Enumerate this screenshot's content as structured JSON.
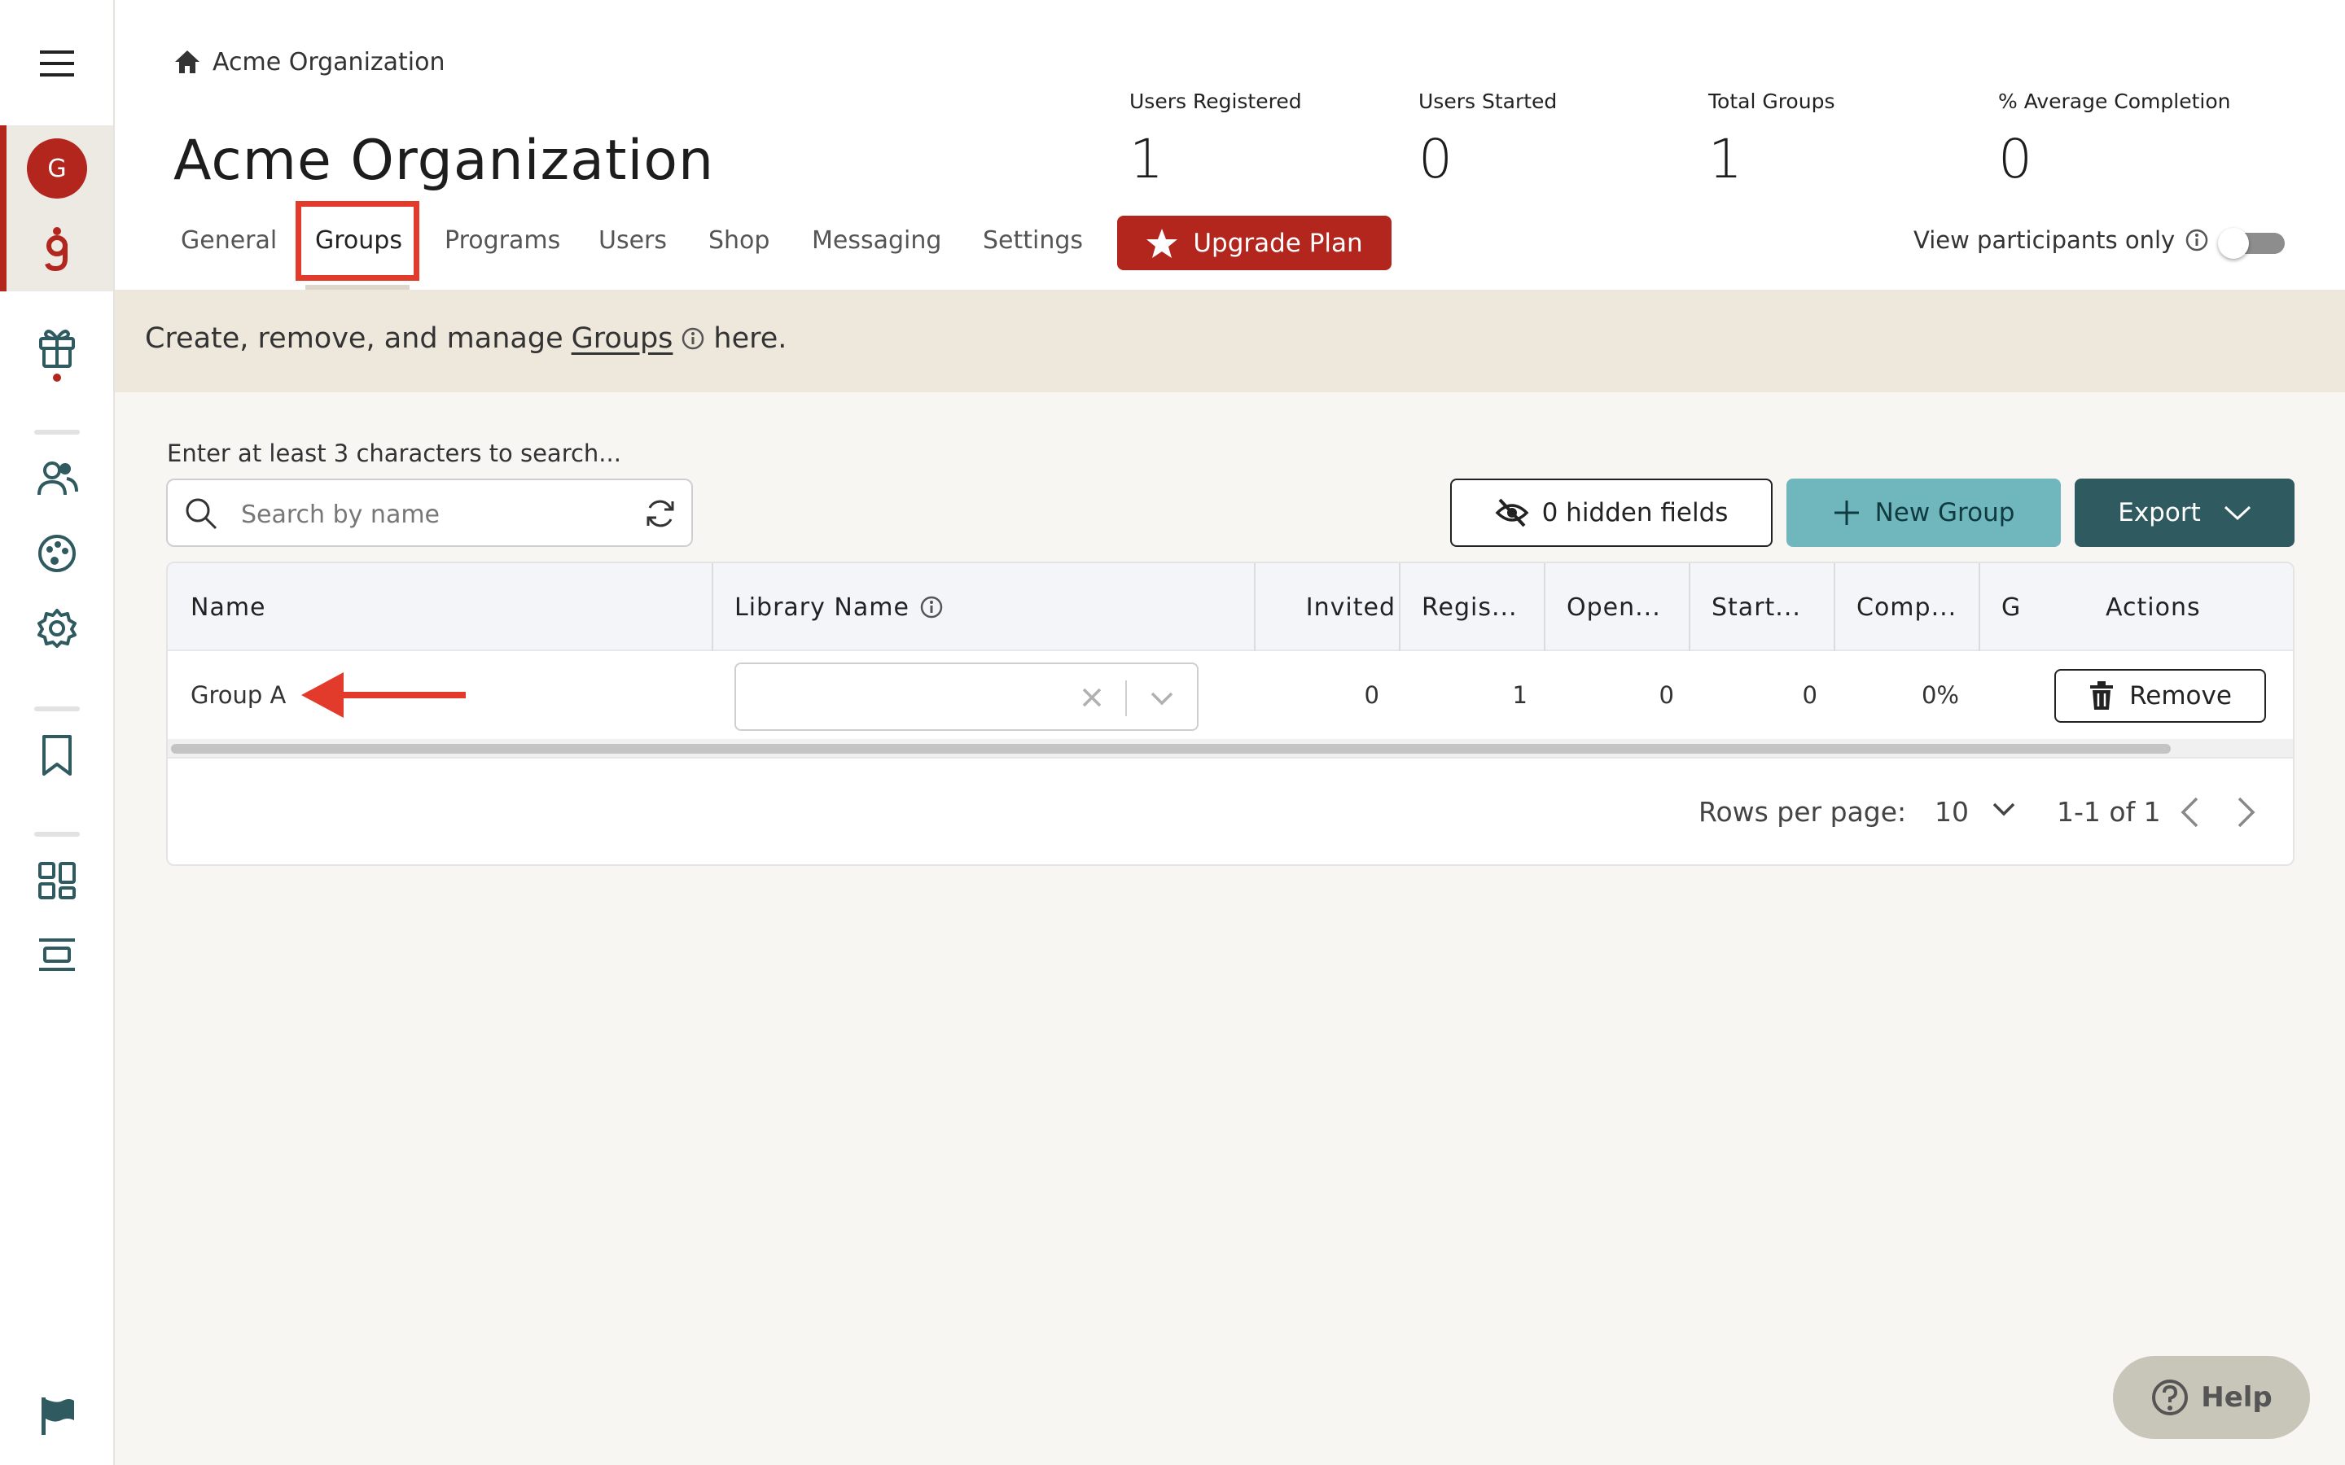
{
  "breadcrumb": {
    "label": "Acme Organization"
  },
  "page_title": "Acme Organization",
  "stats": [
    {
      "label": "Users Registered",
      "value": "1"
    },
    {
      "label": "Users Started",
      "value": "0"
    },
    {
      "label": "Total Groups",
      "value": "1"
    },
    {
      "label": "% Average Completion",
      "value": "0"
    }
  ],
  "tabs": [
    {
      "label": "General"
    },
    {
      "label": "Groups"
    },
    {
      "label": "Programs"
    },
    {
      "label": "Users"
    },
    {
      "label": "Shop"
    },
    {
      "label": "Messaging"
    },
    {
      "label": "Settings"
    }
  ],
  "upgrade_label": "Upgrade Plan",
  "view_participants_label": "View participants only",
  "sidebar": {
    "avatar_letter": "G"
  },
  "banner": {
    "prefix": "Create, remove, and manage",
    "link": "Groups",
    "suffix": "here."
  },
  "search": {
    "hint": "Enter at least 3 characters to search...",
    "placeholder": "Search by name"
  },
  "toolbar": {
    "hidden_fields": "0 hidden fields",
    "new_group": "New Group",
    "export": "Export"
  },
  "table": {
    "columns": [
      "Name",
      "Library Name",
      "Invited",
      "Regis...",
      "Open...",
      "Start...",
      "Comp...",
      "G",
      "Actions"
    ],
    "rows": [
      {
        "name": "Group A",
        "library_name": "",
        "invited": "0",
        "registered": "1",
        "opened": "0",
        "started": "0",
        "completion": "0%",
        "action": "Remove"
      }
    ]
  },
  "pagination": {
    "rows_label": "Rows per page:",
    "rows_value": "10",
    "range": "1-1 of 1"
  },
  "help_label": "Help",
  "colors": {
    "brand": "#b3261e",
    "teal": "#6fb7bd",
    "dark_teal": "#2f5a60",
    "annotation": "#e23a2b"
  }
}
